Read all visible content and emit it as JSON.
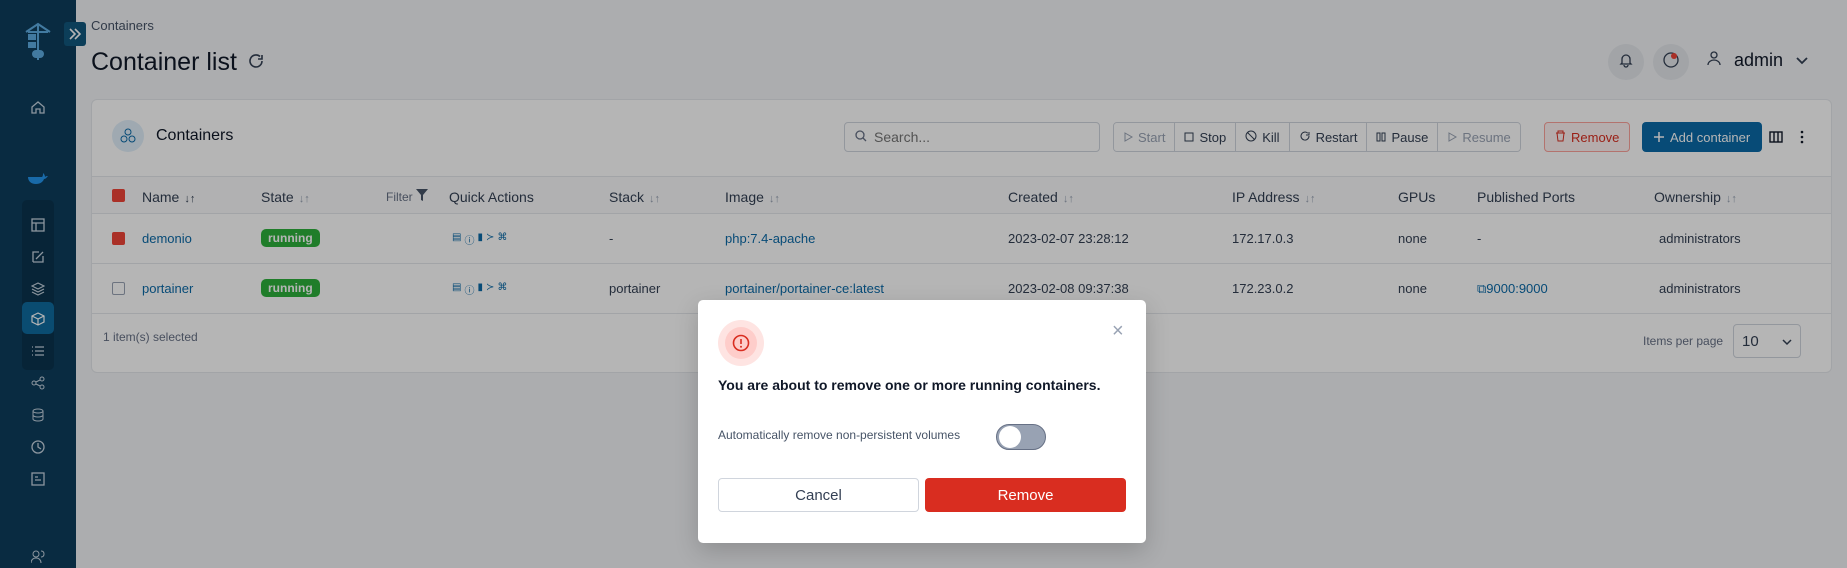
{
  "breadcrumb": "Containers",
  "page": {
    "title": "Container list"
  },
  "header": {
    "username": "admin"
  },
  "panel": {
    "title": "Containers",
    "search_placeholder": "Search...",
    "actions": {
      "start": "Start",
      "stop": "Stop",
      "kill": "Kill",
      "restart": "Restart",
      "pause": "Pause",
      "resume": "Resume",
      "remove": "Remove",
      "add": "Add container"
    },
    "filter_label": "Filter"
  },
  "table": {
    "headers": {
      "name": "Name",
      "state": "State",
      "quick_actions": "Quick Actions",
      "stack": "Stack",
      "image": "Image",
      "created": "Created",
      "ip": "IP Address",
      "gpus": "GPUs",
      "ports": "Published Ports",
      "ownership": "Ownership"
    },
    "rows": [
      {
        "name": "demonio",
        "state": "running",
        "stack": "-",
        "image": "php:7.4-apache",
        "created": "2023-02-07 23:28:12",
        "ip": "172.17.0.3",
        "gpus": "none",
        "ports": "-",
        "ownership": "administrators",
        "selected": true
      },
      {
        "name": "portainer",
        "state": "running",
        "stack": "portainer",
        "image": "portainer/portainer-ce:latest",
        "created": "2023-02-08 09:37:38",
        "ip": "172.23.0.2",
        "gpus": "none",
        "ports": "9000:9000",
        "ownership": "administrators",
        "selected": false
      }
    ],
    "selection_text": "1 item(s) selected",
    "items_per_page_label": "Items per page",
    "items_per_page_value": "10"
  },
  "modal": {
    "message": "You are about to remove one or more running containers.",
    "option_label": "Automatically remove non-persistent volumes",
    "option_enabled": false,
    "close": "×",
    "cancel": "Cancel",
    "confirm": "Remove"
  },
  "colors": {
    "sidebar": "#0e3d5c",
    "accent": "#0b6aa8",
    "danger": "#d92d20",
    "running": "#2eb03c"
  }
}
